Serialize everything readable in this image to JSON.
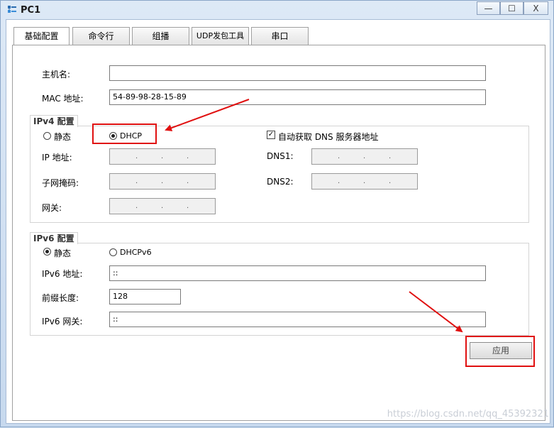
{
  "window": {
    "title": "PC1",
    "minimize": "—",
    "maximize": "☐",
    "close": "X"
  },
  "tabs": [
    "基础配置",
    "命令行",
    "组播",
    "UDP发包工具",
    "串口"
  ],
  "basic": {
    "hostname_label": "主机名:",
    "hostname_value": "",
    "mac_label": "MAC 地址:",
    "mac_value": "54-89-98-28-15-89"
  },
  "ipv4": {
    "title": "IPv4 配置",
    "static_label": "静态",
    "dhcp_label": "DHCP",
    "selected": "DHCP",
    "ip_label": "IP 地址:",
    "mask_label": "子网掩码:",
    "gateway_label": "网关:",
    "auto_dns_label": "自动获取 DNS 服务器地址",
    "auto_dns_checked": true,
    "dns1_label": "DNS1:",
    "dns2_label": "DNS2:"
  },
  "ipv6": {
    "title": "IPv6 配置",
    "static_label": "静态",
    "dhcpv6_label": "DHCPv6",
    "selected": "静态",
    "address_label": "IPv6 地址:",
    "address_value": "::",
    "prefix_label": "前缀长度:",
    "prefix_value": "128",
    "gateway_label": "IPv6 网关:",
    "gateway_value": "::"
  },
  "apply_label": "应用",
  "watermark": "https://blog.csdn.net/qq_45392321",
  "annotation_color": "#e01010"
}
